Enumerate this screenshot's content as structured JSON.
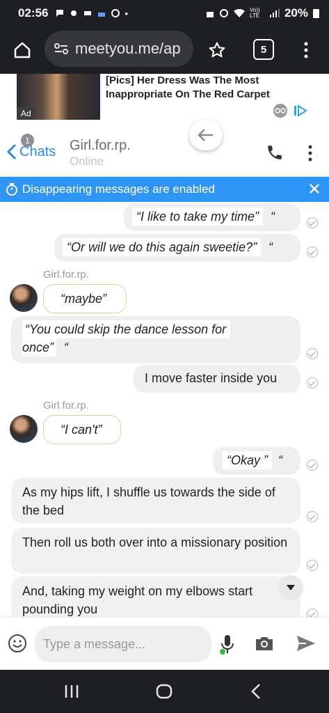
{
  "status_bar": {
    "time": "02:56",
    "signal_label": "Vo)) LTE",
    "battery": "20%"
  },
  "browser": {
    "url": "meetyou.me/ap",
    "tab_count": "5"
  },
  "ad": {
    "label": "Ad",
    "title": "[Pics] Her Dress Was The Most Inappropriate On The Red Carpet"
  },
  "chat_header": {
    "back_label": "Chats",
    "unread_badge": "1",
    "contact_name": "Girl.for.rp.",
    "contact_status": "Online"
  },
  "notice": {
    "text": "Disappearing messages are enabled"
  },
  "messages": [
    {
      "dir": "out",
      "text": "“I like to take my time”",
      "tail": "“"
    },
    {
      "dir": "out",
      "text": "“Or will we do this again sweetie?”",
      "tail": "“"
    },
    {
      "dir": "in",
      "sender": "Girl.for.rp.",
      "text": "“maybe”"
    },
    {
      "dir": "out",
      "text": "“You could skip the dance lesson for",
      "text2": "once”",
      "tail": "“"
    },
    {
      "dir": "out",
      "text": "I move faster inside you"
    },
    {
      "dir": "in",
      "sender": "Girl.for.rp.",
      "text": "“I can't”"
    },
    {
      "dir": "out",
      "text": "“Okay ”",
      "tail": "“"
    },
    {
      "dir": "out",
      "text": "As my hips lift, I shuffle us towards the side of the bed"
    },
    {
      "dir": "out",
      "text": "Then roll us both over into a missionary position"
    },
    {
      "dir": "out",
      "text": "And, taking my weight on my elbows start pounding you"
    }
  ],
  "composer": {
    "placeholder": "Type a message..."
  },
  "colors": {
    "accent": "#2f95f4",
    "link": "#2a8ae6",
    "system_bar": "#1e1f22"
  }
}
